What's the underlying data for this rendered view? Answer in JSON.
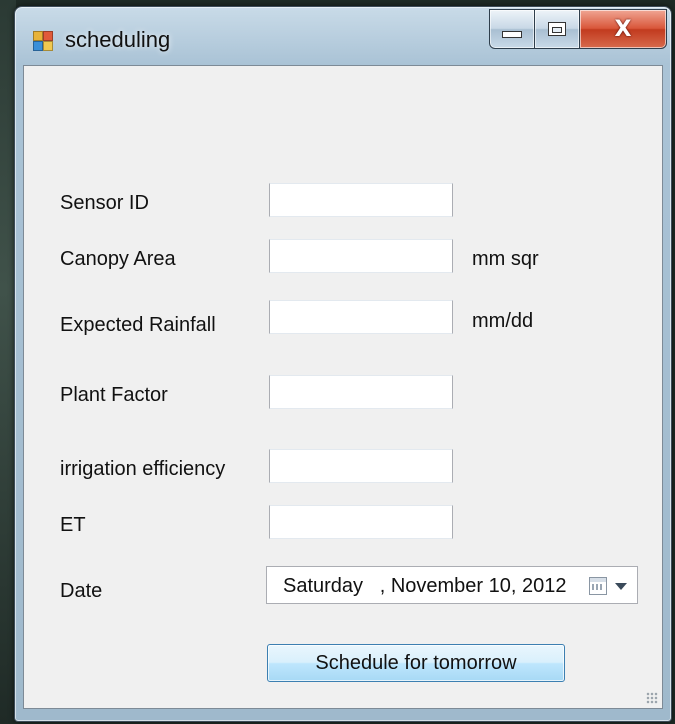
{
  "window": {
    "title": "scheduling",
    "close_glyph": "X"
  },
  "form": {
    "sensor_id": {
      "label": "Sensor ID",
      "value": ""
    },
    "canopy_area": {
      "label": "Canopy Area",
      "value": "",
      "unit": "mm sqr"
    },
    "expected_rainfall": {
      "label": "Expected Rainfall",
      "value": "",
      "unit": "mm/dd"
    },
    "plant_factor": {
      "label": "Plant Factor",
      "value": ""
    },
    "irrigation_efficiency": {
      "label": "irrigation efficiency",
      "value": ""
    },
    "et": {
      "label": "ET",
      "value": ""
    },
    "date": {
      "label": "Date",
      "value": "Saturday   , November 10, 2012"
    }
  },
  "actions": {
    "schedule_label": "Schedule for tomorrow"
  },
  "icons": {
    "app": "form-window-icon",
    "minimize": "minimize-icon",
    "maximize": "maximize-icon",
    "close": "close-icon",
    "calendar": "calendar-icon",
    "dropdown": "chevron-down-icon"
  },
  "colors": {
    "client_bg": "#f0f0f0",
    "close_button": "#c23b1f",
    "button_border": "#3c7fb1"
  }
}
